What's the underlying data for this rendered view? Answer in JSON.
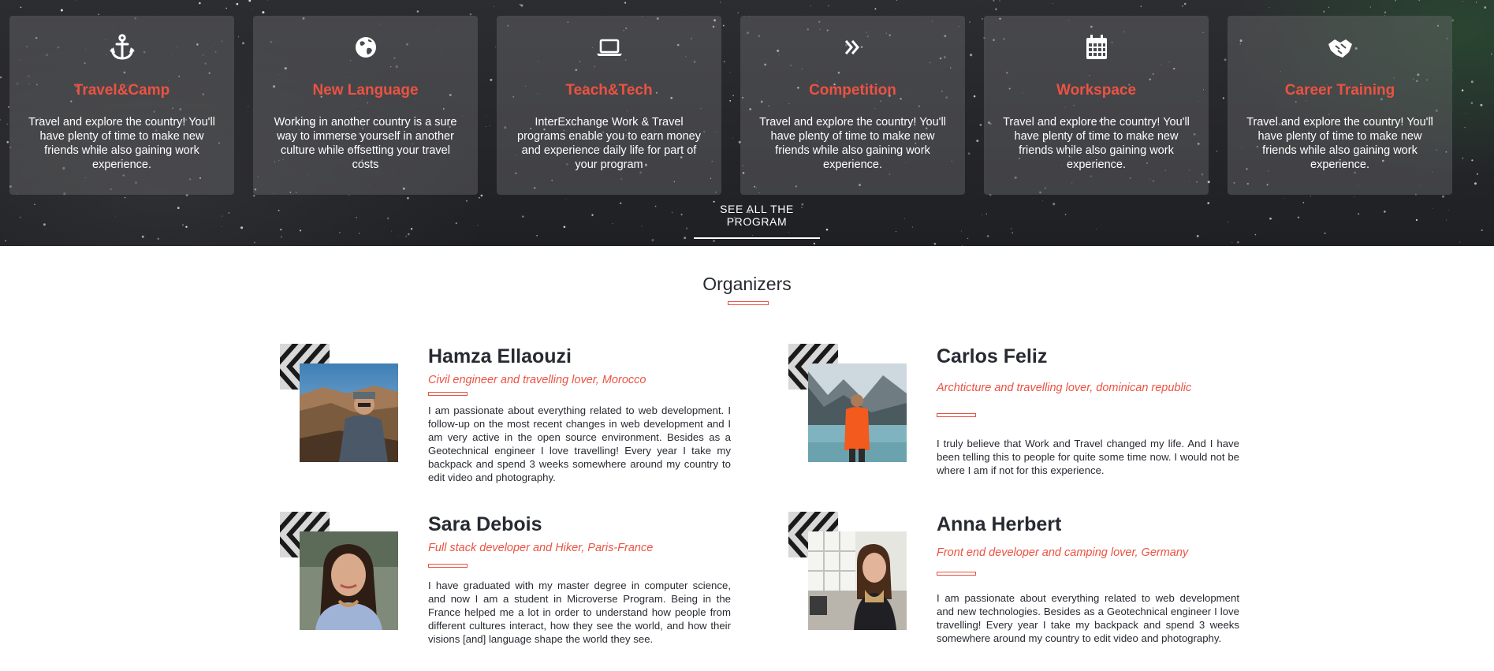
{
  "program": {
    "cards": [
      {
        "icon": "anchor-icon",
        "title": "Travel&Camp",
        "text": "Travel and explore the country! You'll have plenty of time to make new friends while also gaining work experience."
      },
      {
        "icon": "globe-icon",
        "title": "New Language",
        "text": "Working in another country is a sure way to immerse yourself in another culture while offsetting your travel costs"
      },
      {
        "icon": "laptop-icon",
        "title": "Teach&Tech",
        "text": "InterExchange Work & Travel programs enable you to earn money and experience daily life for part of your program"
      },
      {
        "icon": "double-chevron-right-icon",
        "title": "Competition",
        "text": "Travel and explore the country! You'll have plenty of time to make new friends while also gaining work experience."
      },
      {
        "icon": "calendar-icon",
        "title": "Workspace",
        "text": "Travel and explore the country! You'll have plenty of time to make new friends while also gaining work experience."
      },
      {
        "icon": "handshake-icon",
        "title": "Career Training",
        "text": "Travel and explore the country! You'll have plenty of time to make new friends while also gaining work experience."
      }
    ],
    "see_all_label": "SEE ALL THE PROGRAM"
  },
  "organizers": {
    "title": "Organizers",
    "people": [
      {
        "name": "Hamza Ellaouzi",
        "role": "Civil engineer and travelling lover, Morocco",
        "bio": "I am passionate about everything related to web development. I follow-up on the most recent changes in web development and I am very active in the open source environment. Besides as a Geotechnical engineer I love travelling! Every year I take my backpack and spend 3 weeks somewhere around my country to edit video and photography."
      },
      {
        "name": "Carlos Feliz",
        "role": "Archticture and travelling lover, dominican republic",
        "bio": "I truly believe that Work and Travel changed my life. And I have been telling this to people for quite some time now. I would not be where I am if not for this experience."
      },
      {
        "name": "Sara Debois",
        "role": "Full stack developer and Hiker, Paris-France",
        "bio": "I have graduated with my master degree in computer science, and now I am a student in Microverse Program. Being in the France helped me a lot in order to understand how people from different cultures interact, how they see the world, and how their visions [and] language shape the world they see."
      },
      {
        "name": "Anna Herbert",
        "role": "Front end developer and camping lover, Germany",
        "bio": "I am passionate about everything related to web development and new technologies. Besides as a Geotechnical engineer I love travelling! Every year I take my backpack and spend 3 weeks somewhere around my country to edit video and photography."
      }
    ]
  },
  "colors": {
    "accent": "#ec5242",
    "text_dark": "#272a31",
    "card_bg": "rgba(110,110,112,0.42)"
  }
}
